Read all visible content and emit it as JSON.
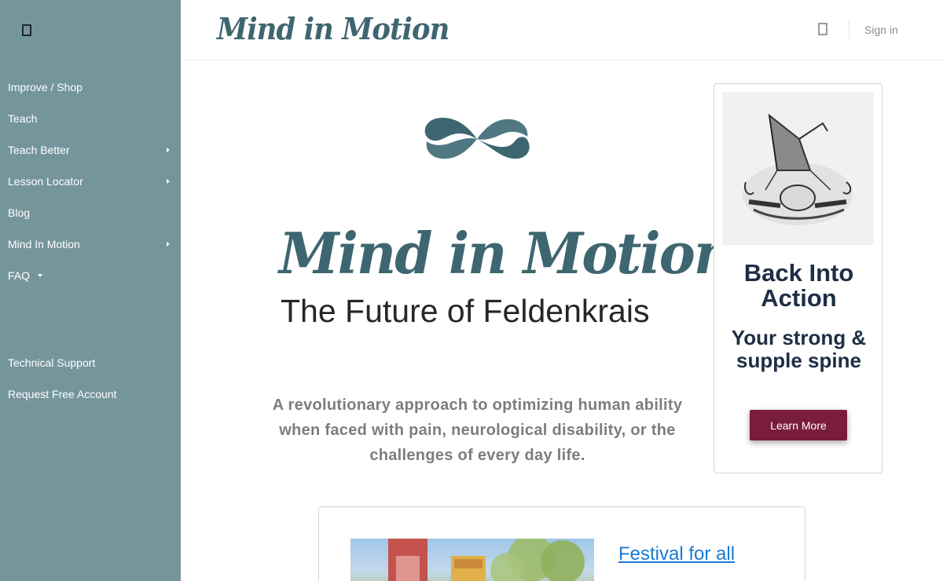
{
  "sidebar": {
    "icon": "mobile-icon",
    "items": [
      {
        "label": "Improve / Shop"
      },
      {
        "label": "Teach"
      },
      {
        "label": "Teach Better"
      },
      {
        "label": "Lesson Locator"
      },
      {
        "label": "Blog"
      },
      {
        "label": "Mind In Motion"
      },
      {
        "label": "FAQ"
      }
    ],
    "secondary": [
      {
        "label": "Technical Support"
      },
      {
        "label": "Request Free Account"
      }
    ]
  },
  "header": {
    "brand": "Mind in Motion",
    "icon": "mobile-icon",
    "signin": "Sign in"
  },
  "hero": {
    "logo_icon": "infinity-icon",
    "title": "Mind in Motion",
    "subtitle": "The Future of Feldenkrais",
    "tagline": "A revolutionary approach to optimizing human ability when faced with pain, neurological disability, or the challenges of every day life."
  },
  "promo": {
    "title": "Back Into Action",
    "subtitle": "Your strong & supple spine",
    "button": "Learn More"
  },
  "festival": {
    "link": "Festival for all"
  },
  "colors": {
    "sidebar": "#75959d",
    "brand": "#3e6670",
    "button": "#7a1d3b",
    "link": "#1a7ad4"
  }
}
